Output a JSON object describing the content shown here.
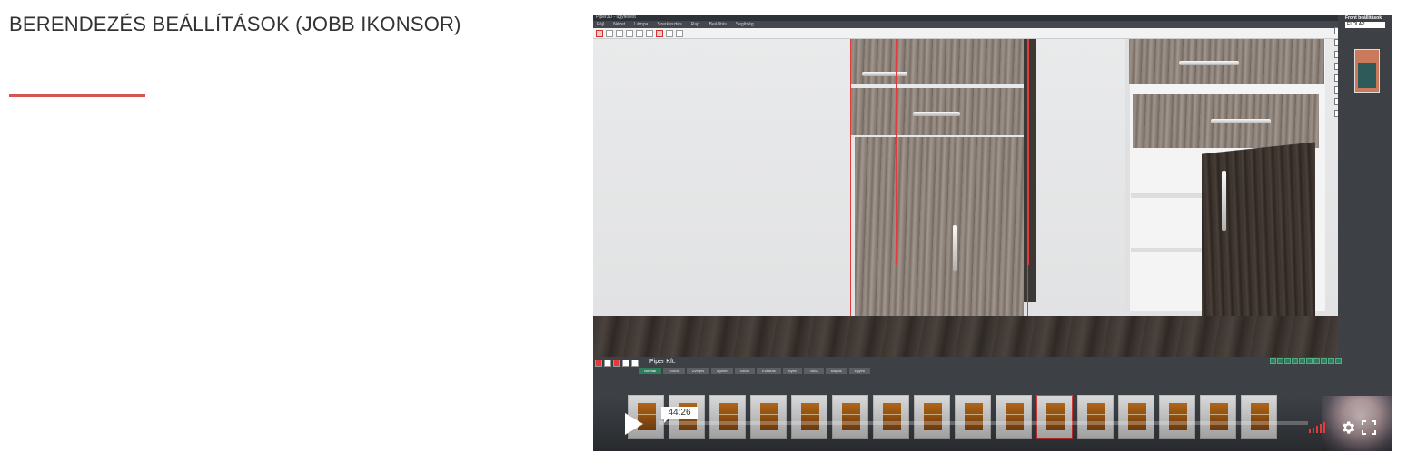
{
  "page": {
    "title": "BERENDEZÉS BEÁLLÍTÁSOK (JOBB IKONSOR)"
  },
  "video": {
    "timestamp": "44:26",
    "app": {
      "window_title": "Piper3D - ügyféltest",
      "menu": [
        "Fájl",
        "Nézet",
        "Lámpa",
        "Szerkesztés",
        "Rajz",
        "Beállítás",
        "Segítség"
      ],
      "company_label": "Piper Kft.",
      "right_panel_title": "Front beállítások",
      "right_panel_field": "ELŐLAP",
      "bottom_tabs": [
        "Normál",
        "Fiókos",
        "Üveges",
        "Nyitott",
        "Sarok",
        "Kosaras",
        "Nyitó",
        "Tálca",
        "Magas",
        "Egyéb"
      ],
      "thumbnail_count": 16
    },
    "accent_color": "#e23b3b",
    "volume_level_bars": 5
  }
}
